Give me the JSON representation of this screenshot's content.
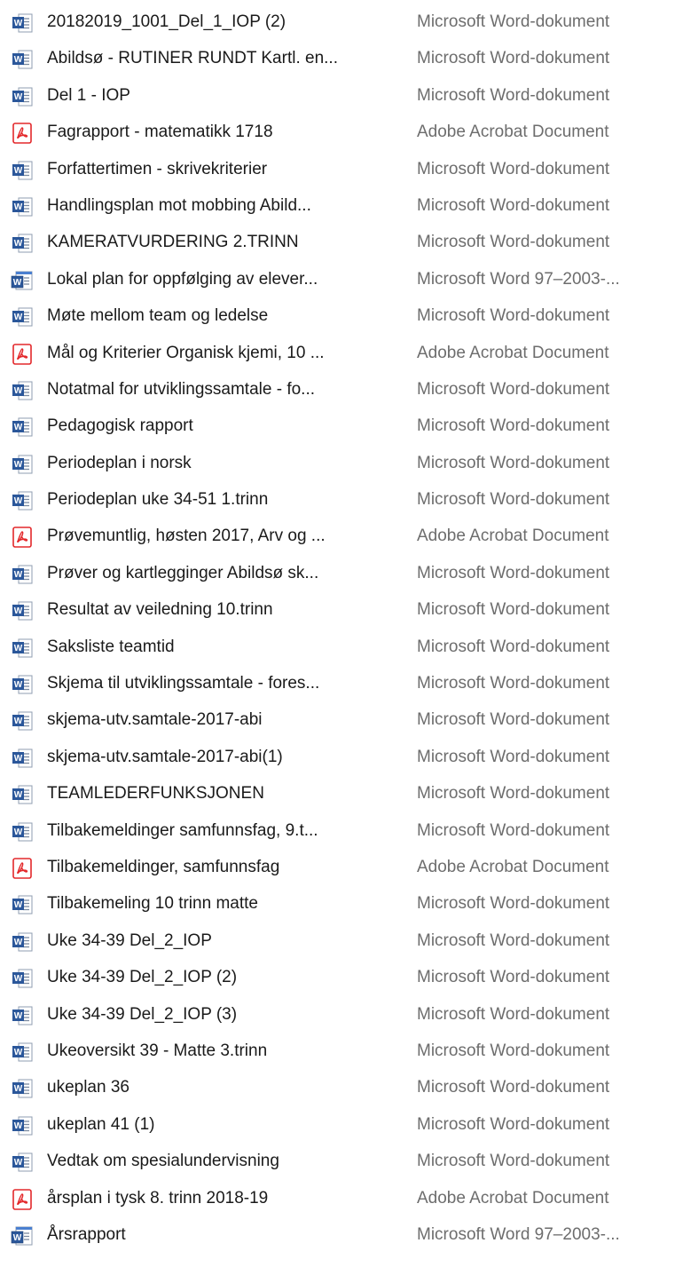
{
  "files": [
    {
      "name": "20182019_1001_Del_1_IOP (2)",
      "type": "Microsoft Word-dokument",
      "icon": "word-document-icon"
    },
    {
      "name": "Abildsø - RUTINER RUNDT Kartl. en...",
      "type": "Microsoft Word-dokument",
      "icon": "word-document-icon"
    },
    {
      "name": "Del 1 - IOP",
      "type": "Microsoft Word-dokument",
      "icon": "word-document-icon"
    },
    {
      "name": "Fagrapport - matematikk 1718",
      "type": "Adobe Acrobat Document",
      "icon": "pdf-document-icon"
    },
    {
      "name": "Forfattertimen -  skrivekriterier",
      "type": "Microsoft Word-dokument",
      "icon": "word-document-icon"
    },
    {
      "name": "Handlingsplan mot mobbing Abild...",
      "type": "Microsoft Word-dokument",
      "icon": "word-document-icon"
    },
    {
      "name": "KAMERATVURDERING 2.TRINN",
      "type": "Microsoft Word-dokument",
      "icon": "word-document-icon"
    },
    {
      "name": "Lokal plan for oppfølging av elever...",
      "type": "Microsoft Word 97–2003-...",
      "icon": "word-97-document-icon"
    },
    {
      "name": "Møte mellom team og ledelse",
      "type": "Microsoft Word-dokument",
      "icon": "word-document-icon"
    },
    {
      "name": "Mål og Kriterier Organisk kjemi, 10 ...",
      "type": "Adobe Acrobat Document",
      "icon": "pdf-document-icon"
    },
    {
      "name": "Notatmal for utviklingssamtale - fo...",
      "type": "Microsoft Word-dokument",
      "icon": "word-document-icon"
    },
    {
      "name": "Pedagogisk rapport",
      "type": "Microsoft Word-dokument",
      "icon": "word-document-icon"
    },
    {
      "name": "Periodeplan i norsk",
      "type": "Microsoft Word-dokument",
      "icon": "word-document-icon"
    },
    {
      "name": "Periodeplan uke 34-51 1.trinn",
      "type": "Microsoft Word-dokument",
      "icon": "word-document-icon"
    },
    {
      "name": "Prøvemuntlig, høsten 2017, Arv og ...",
      "type": "Adobe Acrobat Document",
      "icon": "pdf-document-icon"
    },
    {
      "name": "Prøver og kartlegginger Abildsø sk...",
      "type": "Microsoft Word-dokument",
      "icon": "word-document-icon"
    },
    {
      "name": "Resultat av veiledning 10.trinn",
      "type": "Microsoft Word-dokument",
      "icon": "word-document-icon"
    },
    {
      "name": "Saksliste teamtid",
      "type": "Microsoft Word-dokument",
      "icon": "word-document-icon"
    },
    {
      "name": "Skjema til utviklingssamtale - fores...",
      "type": "Microsoft Word-dokument",
      "icon": "word-document-icon"
    },
    {
      "name": "skjema-utv.samtale-2017-abi",
      "type": "Microsoft Word-dokument",
      "icon": "word-document-icon"
    },
    {
      "name": "skjema-utv.samtale-2017-abi(1)",
      "type": "Microsoft Word-dokument",
      "icon": "word-document-icon"
    },
    {
      "name": "TEAMLEDERFUNKSJONEN",
      "type": "Microsoft Word-dokument",
      "icon": "word-document-icon"
    },
    {
      "name": "Tilbakemeldinger samfunnsfag, 9.t...",
      "type": "Microsoft Word-dokument",
      "icon": "word-document-icon"
    },
    {
      "name": "Tilbakemeldinger, samfunnsfag",
      "type": "Adobe Acrobat Document",
      "icon": "pdf-document-icon"
    },
    {
      "name": "Tilbakemeling 10 trinn matte",
      "type": "Microsoft Word-dokument",
      "icon": "word-document-icon"
    },
    {
      "name": "Uke 34-39 Del_2_IOP",
      "type": "Microsoft Word-dokument",
      "icon": "word-document-icon"
    },
    {
      "name": "Uke 34-39 Del_2_IOP (2)",
      "type": "Microsoft Word-dokument",
      "icon": "word-document-icon"
    },
    {
      "name": "Uke 34-39 Del_2_IOP (3)",
      "type": "Microsoft Word-dokument",
      "icon": "word-document-icon"
    },
    {
      "name": "Ukeoversikt 39 - Matte 3.trinn",
      "type": "Microsoft Word-dokument",
      "icon": "word-document-icon"
    },
    {
      "name": "ukeplan 36",
      "type": "Microsoft Word-dokument",
      "icon": "word-document-icon"
    },
    {
      "name": "ukeplan 41 (1)",
      "type": "Microsoft Word-dokument",
      "icon": "word-document-icon"
    },
    {
      "name": "Vedtak om spesialundervisning",
      "type": "Microsoft Word-dokument",
      "icon": "word-document-icon"
    },
    {
      "name": "årsplan i tysk 8. trinn 2018-19",
      "type": "Adobe Acrobat Document",
      "icon": "pdf-document-icon"
    },
    {
      "name": "Årsrapport",
      "type": "Microsoft Word 97–2003-...",
      "icon": "word-97-document-icon"
    }
  ],
  "colors": {
    "word_blue": "#2b579a",
    "word_light": "#4a7fd0",
    "pdf_red": "#e3282b",
    "name_text": "#1a1a1a",
    "type_text": "#6d6d6d"
  }
}
